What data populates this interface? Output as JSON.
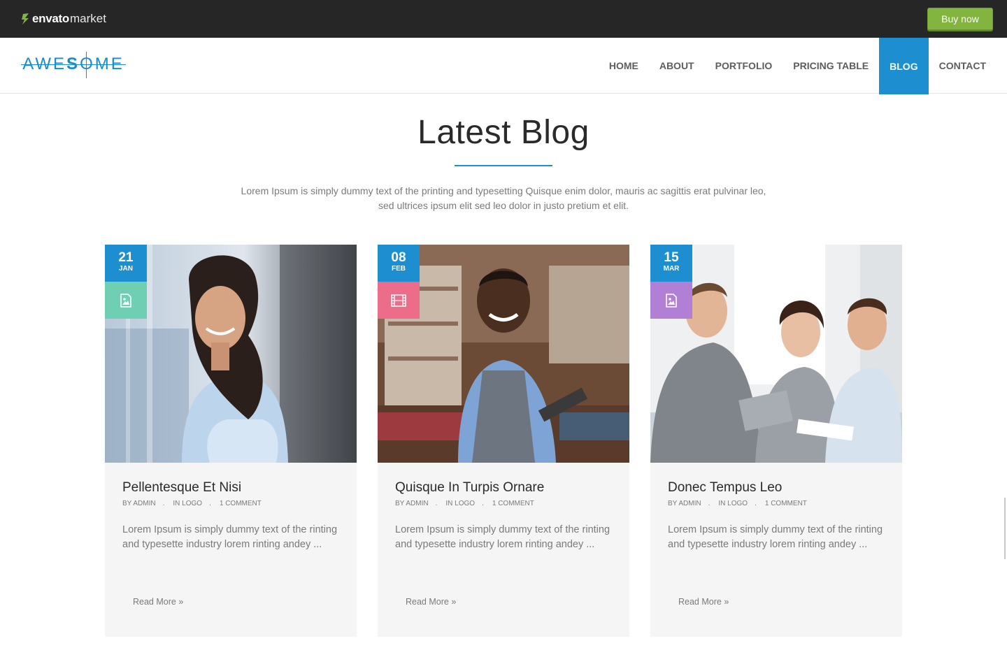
{
  "topbar": {
    "brand": "envato",
    "brand_suffix": "market",
    "buy_label": "Buy now",
    "accent": "#82b440"
  },
  "site": {
    "logo_text_1": "AWE",
    "logo_text_2": "S",
    "logo_text_3": "OME",
    "logo_color": "#1a8ccb"
  },
  "nav": {
    "items": [
      "HOME",
      "ABOUT",
      "PORTFOLIO",
      "PRICING TABLE",
      "BLOG",
      "CONTACT"
    ],
    "active": "BLOG",
    "active_color": "#1d8ed0"
  },
  "section": {
    "title": "Latest Blog",
    "desc_line1": "Lorem Ipsum is simply dummy text of the printing and typesetting Quisque enim dolor, mauris ac sagittis erat pulvinar leo,",
    "desc_line2": "sed ultrices ipsum elit sed leo dolor in justo pretium et elit."
  },
  "posts": [
    {
      "day": "21",
      "month": "JAN",
      "type_icon": "image-icon",
      "type_color": "#6fcfb3",
      "title": "Pellentesque Et Nisi",
      "author": "BY ADMIN",
      "category": "IN LOGO",
      "comments": "1 COMMENT",
      "excerpt": "Lorem Ipsum is simply dummy text of the rinting and typesette industry lorem rinting andey ...",
      "read_more": "Read More"
    },
    {
      "day": "08",
      "month": "FEB",
      "type_icon": "film-icon",
      "type_color": "#ec6d8a",
      "title": "Quisque In Turpis Ornare",
      "author": "BY ADMIN",
      "category": "IN LOGO",
      "comments": "1 COMMENT",
      "excerpt": "Lorem Ipsum is simply dummy text of the rinting and typesette industry lorem rinting andey ...",
      "read_more": "Read More"
    },
    {
      "day": "15",
      "month": "MAR",
      "type_icon": "image-icon",
      "type_color": "#b17fd6",
      "title": "Donec Tempus Leo",
      "author": "BY ADMIN",
      "category": "IN LOGO",
      "comments": "1 COMMENT",
      "excerpt": "Lorem Ipsum is simply dummy text of the rinting and typesette industry lorem rinting andey ...",
      "read_more": "Read More"
    }
  ]
}
